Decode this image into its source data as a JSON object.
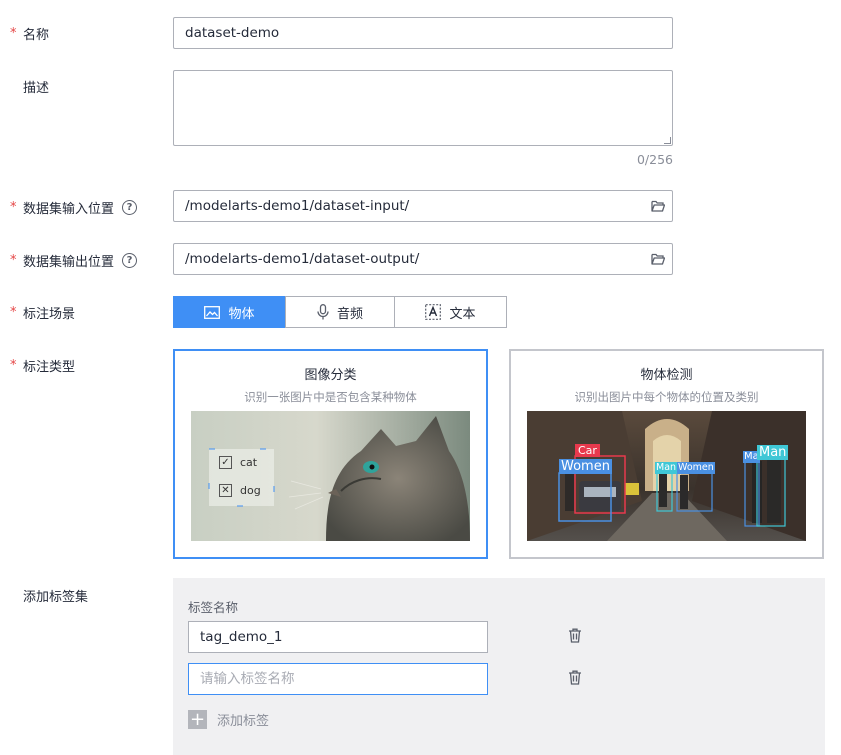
{
  "form": {
    "name": {
      "label": "名称",
      "required": true,
      "value": "dataset-demo"
    },
    "description": {
      "label": "描述",
      "value": "",
      "counter": "0/256"
    },
    "input_location": {
      "label": "数据集输入位置",
      "required": true,
      "value": "/modelarts-demo1/dataset-input/",
      "help": "?"
    },
    "output_location": {
      "label": "数据集输出位置",
      "required": true,
      "value": "/modelarts-demo1/dataset-output/",
      "help": "?"
    },
    "scene": {
      "label": "标注场景",
      "required": true,
      "options": [
        {
          "label": "物体",
          "icon": "image-icon",
          "active": true
        },
        {
          "label": "音频",
          "icon": "microphone-icon",
          "active": false
        },
        {
          "label": "文本",
          "icon": "text-box-icon",
          "active": false
        }
      ]
    },
    "type": {
      "label": "标注类型",
      "required": true,
      "cards": [
        {
          "title": "图像分类",
          "subtitle": "识别一张图片中是否包含某种物体",
          "selected": true,
          "choices": [
            "cat",
            "dog"
          ]
        },
        {
          "title": "物体检测",
          "subtitle": "识别出图片中每个物体的位置及类别",
          "selected": false,
          "boxes": [
            "Car",
            "Women",
            "Man",
            "Women",
            "Ma",
            "Man"
          ]
        }
      ]
    },
    "tag_set": {
      "label": "添加标签集",
      "column_header": "标签名称",
      "tags": [
        {
          "value": "tag_demo_1",
          "placeholder": ""
        },
        {
          "value": "",
          "placeholder": "请输入标签名称"
        }
      ],
      "add_label": "添加标签"
    }
  },
  "colors": {
    "required_star": "#e54545",
    "primary": "#3f8ff5",
    "border": "#adb0b8",
    "panel_bg": "#f0f0f2",
    "detect_box_blue": "#4a90e2",
    "detect_box_red": "#e8394d",
    "detect_box_cyan": "#3fc7d6"
  }
}
